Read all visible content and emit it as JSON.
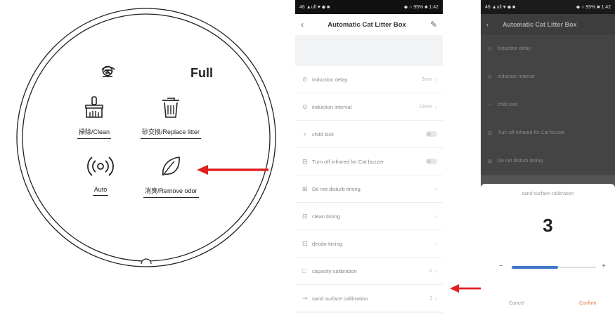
{
  "device": {
    "status_full": "Full",
    "buttons": {
      "clean": "掃除/Clean",
      "replace_litter": "砂交換/Replace litter",
      "auto": "Auto",
      "remove_odor": "消臭/Remove odor"
    }
  },
  "phone1": {
    "status_left": "46 ▲ull ♥ ◆ ■",
    "status_right": "◆ ○ 95% ■ 1:42",
    "title": "Automatic Cat Litter Box",
    "rows": [
      {
        "icon": "⊙",
        "label": "Induction delay",
        "value": "3min",
        "control": "chevron"
      },
      {
        "icon": "⊙",
        "label": "induction interval",
        "value": "15min",
        "control": "chevron"
      },
      {
        "icon": "♁",
        "label": "child lock",
        "value": "",
        "control": "toggle"
      },
      {
        "icon": "⊟",
        "label": "Turn off infrared for Cat buzzer",
        "value": "",
        "control": "toggle"
      },
      {
        "icon": "⊞",
        "label": "Do not disturb timing",
        "value": "",
        "control": "chevron"
      },
      {
        "icon": "⊡",
        "label": "clean timing",
        "value": "",
        "control": "chevron"
      },
      {
        "icon": "⊡",
        "label": "deodo timing",
        "value": "",
        "control": "chevron"
      },
      {
        "icon": "□",
        "label": "capacity calibration",
        "value": "0",
        "control": "chevron"
      },
      {
        "icon": "⊸",
        "label": "sand surface calibration",
        "value": "3",
        "control": "chevron"
      }
    ]
  },
  "phone2": {
    "status_left": "46 ▲ull ♥ ◆ ■",
    "status_right": "◆ ○ 95% ■ 1:42",
    "title": "Automatic Cat Litter Box",
    "rows": [
      {
        "icon": "⊙",
        "label": "Induction delay"
      },
      {
        "icon": "⊙",
        "label": "induction interval"
      },
      {
        "icon": "♁",
        "label": "child lock"
      },
      {
        "icon": "⊟",
        "label": "Turn off infrared for Cat buzzer"
      },
      {
        "icon": "⊞",
        "label": "Do not disturb timing"
      }
    ],
    "sheet": {
      "title": "sand surface calibration",
      "value": "3",
      "slider_fraction": 0.55,
      "minus": "−",
      "plus": "+",
      "cancel": "Cancel",
      "confirm": "Confirm"
    }
  },
  "colors": {
    "arrow": "#e02020",
    "accent_blue": "#3c78c8",
    "confirm_orange": "#e8703a"
  }
}
